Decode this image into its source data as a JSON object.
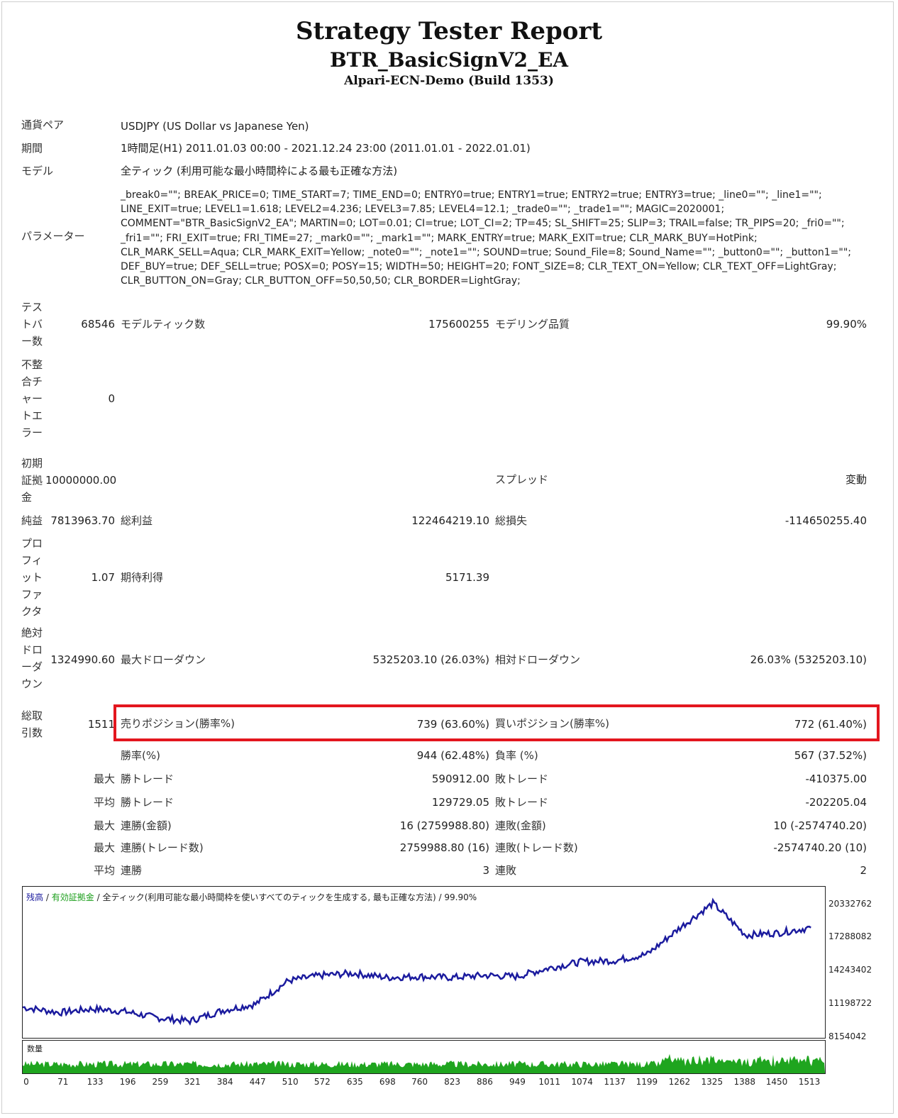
{
  "header": {
    "title": "Strategy Tester Report",
    "ea_name": "BTR_BasicSignV2_EA",
    "server": "Alpari-ECN-Demo (Build 1353)"
  },
  "info": {
    "pair_label": "通貨ペア",
    "pair_value": "USDJPY (US Dollar vs Japanese Yen)",
    "period_label": "期間",
    "period_value": "1時間足(H1) 2011.01.03 00:00 - 2021.12.24 23:00 (2011.01.01 - 2022.01.01)",
    "model_label": "モデル",
    "model_value": "全ティック (利用可能な最小時間枠による最も正確な方法)",
    "params_label": "パラメーター",
    "params_value": "_break0=\"\"; BREAK_PRICE=0; TIME_START=7; TIME_END=0; ENTRY0=true; ENTRY1=true; ENTRY2=true; ENTRY3=true; _line0=\"\"; _line1=\"\"; LINE_EXIT=true; LEVEL1=1.618; LEVEL2=4.236; LEVEL3=7.85; LEVEL4=12.1; _trade0=\"\"; _trade1=\"\"; MAGIC=2020001; COMMENT=\"BTR_BasicSignV2_EA\"; MARTIN=0; LOT=0.01; CI=true; LOT_CI=2; TP=45; SL_SHIFT=25; SLIP=3; TRAIL=false; TR_PIPS=20; _fri0=\"\"; _fri1=\"\"; FRI_EXIT=true; FRI_TIME=27; _mark0=\"\"; _mark1=\"\"; MARK_ENTRY=true; MARK_EXIT=true; CLR_MARK_BUY=HotPink; CLR_MARK_SELL=Aqua; CLR_MARK_EXIT=Yellow; _note0=\"\"; _note1=\"\"; SOUND=true; Sound_File=8; Sound_Name=\"\"; _button0=\"\"; _button1=\"\"; DEF_BUY=true; DEF_SELL=true; POSX=0; POSY=15; WIDTH=50; HEIGHT=20; FONT_SIZE=8; CLR_TEXT_ON=Yellow; CLR_TEXT_OFF=LightGray; CLR_BUTTON_ON=Gray; CLR_BUTTON_OFF=50,50,50; CLR_BORDER=LightGray;"
  },
  "stats": {
    "test_bars_label": "テストバー数",
    "test_bars": "68546",
    "model_ticks_label": "モデルティック数",
    "model_ticks": "175600255",
    "modeling_quality_label": "モデリング品質",
    "modeling_quality": "99.90%",
    "mismatch_label": "不整合チャートエラー",
    "mismatch": "0",
    "deposit_label": "初期証拠金",
    "deposit": "10000000.00",
    "spread_label": "スプレッド",
    "spread": "変動",
    "net_label": "純益",
    "net": "7813963.70",
    "gross_profit_label": "総利益",
    "gross_profit": "122464219.10",
    "gross_loss_label": "総損失",
    "gross_loss": "-114650255.40",
    "pf_label": "プロフィットファクタ",
    "pf": "1.07",
    "expected_label": "期待利得",
    "expected": "5171.39",
    "abs_dd_label": "絶対ドローダウン",
    "abs_dd": "1324990.60",
    "max_dd_label": "最大ドローダウン",
    "max_dd": "5325203.10 (26.03%)",
    "rel_dd_label": "相対ドローダウン",
    "rel_dd": "26.03% (5325203.10)",
    "total_trades_label": "総取引数",
    "total_trades": "1511",
    "short_label": "売りポジション(勝率%)",
    "short": "739 (63.60%)",
    "long_label": "買いポジション(勝率%)",
    "long": "772 (61.40%)",
    "win_label": "勝率(%)",
    "win": "944 (62.48%)",
    "loss_label": "負率 (%)",
    "loss": "567 (37.52%)",
    "max_label": "最大",
    "avg_label": "平均",
    "largest_win_label": "勝トレード",
    "largest_win": "590912.00",
    "largest_loss_label": "敗トレード",
    "largest_loss": "-410375.00",
    "avg_win_label": "勝トレード",
    "avg_win": "129729.05",
    "avg_loss_label": "敗トレード",
    "avg_loss": "-202205.04",
    "consec_win_amt_label": "連勝(金額)",
    "consec_win_amt": "16 (2759988.80)",
    "consec_loss_amt_label": "連敗(金額)",
    "consec_loss_amt": "10 (-2574740.20)",
    "consec_win_cnt_label": "連勝(トレード数)",
    "consec_win_cnt": "2759988.80 (16)",
    "consec_loss_cnt_label": "連敗(トレード数)",
    "consec_loss_cnt": "-2574740.20 (10)",
    "avg_consec_win_label": "連勝",
    "avg_consec_win": "3",
    "avg_consec_loss_label": "連敗",
    "avg_consec_loss": "2"
  },
  "chart_data": {
    "type": "line",
    "legend_balance": "残高",
    "legend_sep": "/",
    "legend_equity": "有効証拠金",
    "legend_model": "全ティック(利用可能な最小時間枠を使いすべてのティックを生成する, 最も正確な方法)",
    "legend_quality": "99.90%",
    "volume_label": "数量",
    "colors": {
      "balance": "#1b1b9e",
      "volume": "#1fa51f"
    },
    "ylim": [
      8154042,
      21855070
    ],
    "y_ticks": [
      "20332762",
      "17288082",
      "14243402",
      "11198722",
      "8154042"
    ],
    "x_ticks": [
      "0",
      "71",
      "133",
      "196",
      "259",
      "321",
      "384",
      "447",
      "510",
      "572",
      "635",
      "698",
      "760",
      "823",
      "886",
      "949",
      "1011",
      "1074",
      "1137",
      "1199",
      "1262",
      "1325",
      "1388",
      "1450",
      "1513"
    ],
    "x": [
      0,
      71,
      133,
      196,
      259,
      321,
      384,
      447,
      510,
      572,
      635,
      698,
      760,
      823,
      886,
      949,
      1011,
      1074,
      1137,
      1199,
      1262,
      1325,
      1388,
      1450,
      1513
    ],
    "series": [
      {
        "values": [
          10500000,
          10000000,
          10350000,
          10100000,
          9500000,
          9200000,
          10200000,
          10800000,
          13000000,
          13500000,
          13700000,
          13300000,
          13400000,
          13300000,
          13500000,
          13400000,
          14200000,
          14800000,
          14900000,
          15500000,
          18000000,
          20300000,
          17300000,
          17500000,
          18000000
        ]
      }
    ]
  }
}
